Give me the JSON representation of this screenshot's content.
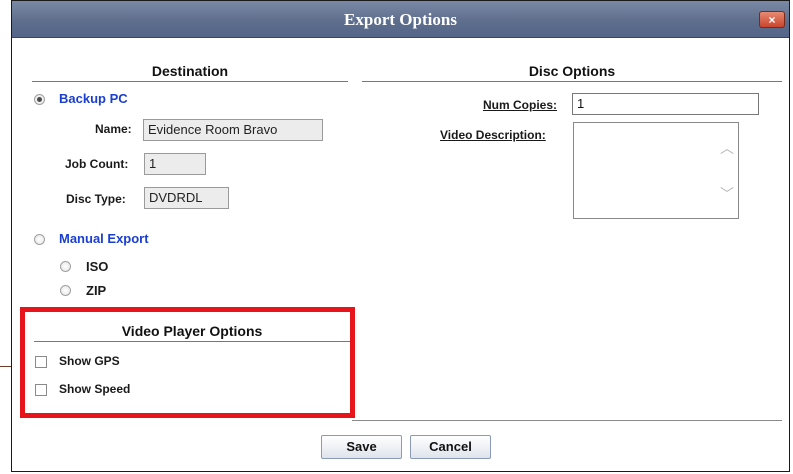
{
  "dialog": {
    "title": "Export Options",
    "close_glyph": "×"
  },
  "destination": {
    "heading": "Destination",
    "backup_pc": {
      "label": "Backup PC",
      "selected": true,
      "name_label": "Name:",
      "name_value": "Evidence Room Bravo",
      "job_count_label": "Job Count:",
      "job_count_value": "1",
      "disc_type_label": "Disc Type:",
      "disc_type_value": "DVDRDL"
    },
    "manual_export": {
      "label": "Manual Export",
      "selected": false,
      "options": [
        {
          "label": "ISO",
          "selected": false
        },
        {
          "label": "ZIP",
          "selected": false
        }
      ]
    }
  },
  "disc_options": {
    "heading": "Disc Options",
    "num_copies_label": "Num Copies:",
    "num_copies_value": "1",
    "video_description_label": "Video Description:",
    "video_description_value": ""
  },
  "video_player_options": {
    "heading": "Video Player Options",
    "show_gps_label": "Show GPS",
    "show_gps_checked": false,
    "show_speed_label": "Show Speed",
    "show_speed_checked": false
  },
  "buttons": {
    "save": "Save",
    "cancel": "Cancel"
  },
  "colors": {
    "titlebar": "#5e6e8c",
    "link_blue": "#1a3fd0",
    "highlight_red": "#e8141c"
  }
}
